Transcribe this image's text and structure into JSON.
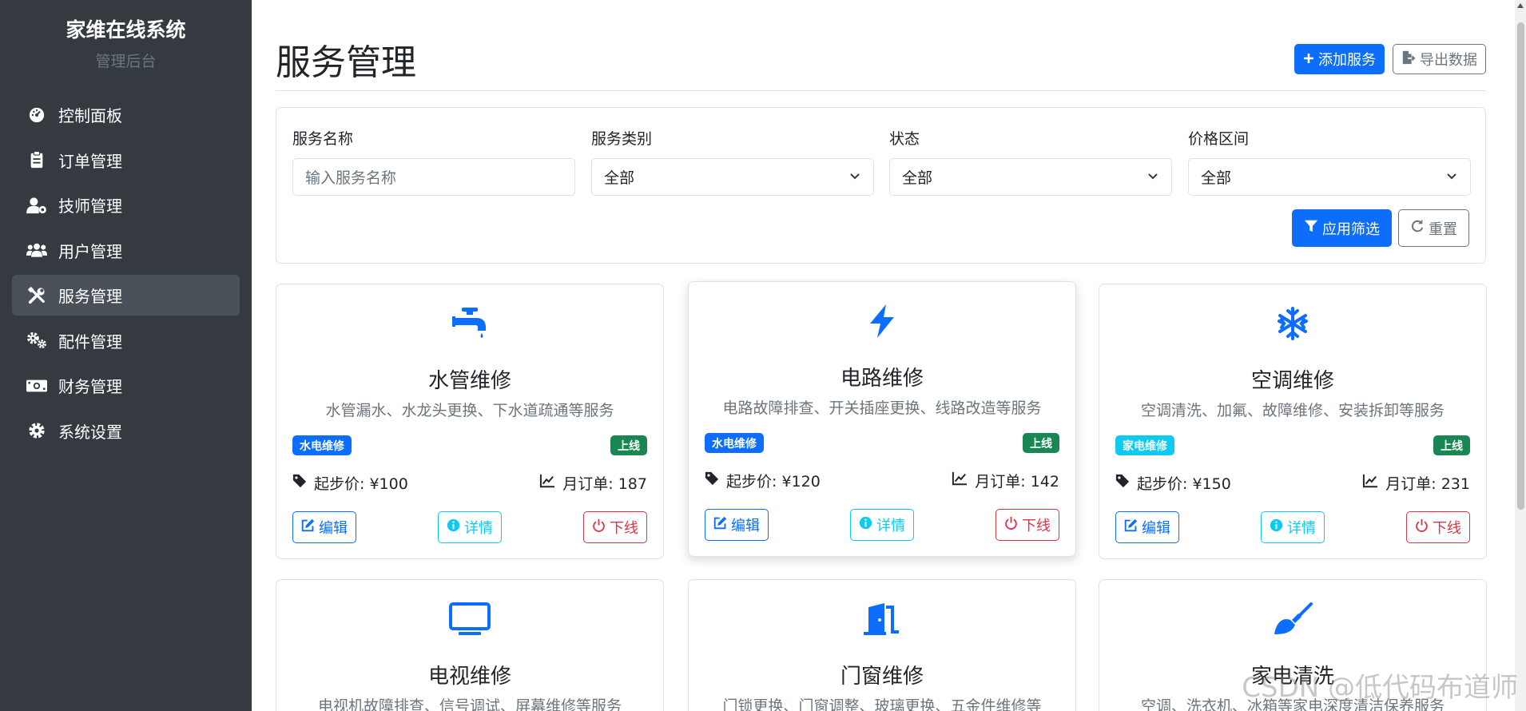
{
  "sidebar": {
    "brand": "家维在线系统",
    "subtitle": "管理后台",
    "items": [
      {
        "label": "控制面板",
        "icon": "dashboard-icon"
      },
      {
        "label": "订单管理",
        "icon": "clipboard-icon"
      },
      {
        "label": "技师管理",
        "icon": "user-gear-icon"
      },
      {
        "label": "用户管理",
        "icon": "users-icon"
      },
      {
        "label": "服务管理",
        "icon": "tools-icon",
        "active": true
      },
      {
        "label": "配件管理",
        "icon": "cogs-icon"
      },
      {
        "label": "财务管理",
        "icon": "money-icon"
      },
      {
        "label": "系统设置",
        "icon": "gear-icon"
      }
    ]
  },
  "header": {
    "title": "服务管理",
    "add_label": "添加服务",
    "export_label": "导出数据"
  },
  "filters": {
    "name_label": "服务名称",
    "name_placeholder": "输入服务名称",
    "category_label": "服务类别",
    "category_value": "全部",
    "status_label": "状态",
    "status_value": "全部",
    "price_label": "价格区间",
    "price_value": "全部",
    "apply_label": "应用筛选",
    "reset_label": "重置"
  },
  "cards": [
    {
      "title": "水管维修",
      "desc": "水管漏水、水龙头更换、下水道疏通等服务",
      "category": "水电维修",
      "status": "上线",
      "price": "起步价: ¥100",
      "orders": "月订单: 187",
      "icon": "faucet-icon"
    },
    {
      "title": "电路维修",
      "desc": "电路故障排查、开关插座更换、线路改造等服务",
      "category": "水电维修",
      "status": "上线",
      "price": "起步价: ¥120",
      "orders": "月订单: 142",
      "icon": "bolt-icon"
    },
    {
      "title": "空调维修",
      "desc": "空调清洗、加氟、故障维修、安装拆卸等服务",
      "category": "家电维修",
      "status": "上线",
      "price": "起步价: ¥150",
      "orders": "月订单: 231",
      "icon": "snowflake-icon"
    },
    {
      "title": "电视维修",
      "desc": "电视机故障排查、信号调试、屏幕维修等服务",
      "icon": "tv-icon"
    },
    {
      "title": "门窗维修",
      "desc": "门锁更换、门窗调整、玻璃更换、五金件维修等",
      "icon": "door-icon"
    },
    {
      "title": "家电清洗",
      "desc": "空调、洗衣机、冰箱等家电深度清洁保养服务",
      "icon": "brush-icon"
    }
  ],
  "card_actions": {
    "edit": "编辑",
    "detail": "详情",
    "offline": "下线"
  },
  "watermark": "CSDN @低代码布道师",
  "colors": {
    "primary": "#0d6efd",
    "info": "#0dcaf0",
    "success": "#198754",
    "danger": "#dc3545",
    "sidebar": "#343a40"
  }
}
